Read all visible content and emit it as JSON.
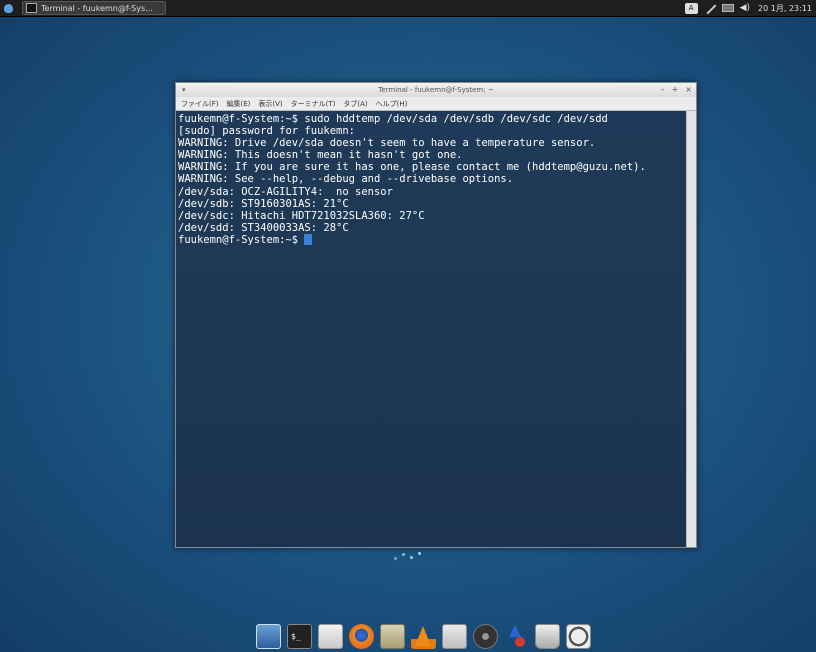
{
  "panel": {
    "task_title": "Terminal - fuukemn@f-Sys...",
    "keyboard_indicator": "A",
    "clock": "20 1月, 23:11",
    "volume_glyph": "◀)"
  },
  "window": {
    "title": "Terminal - fuukemn@f-System: ~",
    "menu": [
      "ファイル(F)",
      "編集(E)",
      "表示(V)",
      "ターミナル(T)",
      "タブ(A)",
      "ヘルプ(H)"
    ]
  },
  "terminal": {
    "lines": [
      "fuukemn@f-System:~$ sudo hddtemp /dev/sda /dev/sdb /dev/sdc /dev/sdd",
      "[sudo] password for fuukemn:",
      "WARNING: Drive /dev/sda doesn't seem to have a temperature sensor.",
      "WARNING: This doesn't mean it hasn't got one.",
      "WARNING: If you are sure it has one, please contact me (hddtemp@guzu.net).",
      "WARNING: See --help, --debug and --drivebase options.",
      "/dev/sda: OCZ-AGILITY4:  no sensor",
      "/dev/sdb: ST9160301AS: 21°C",
      "/dev/sdc: Hitachi HDT721032SLA360: 27°C",
      "/dev/sdd: ST3400033AS: 28°C"
    ],
    "prompt": "fuukemn@f-System:~$ "
  },
  "dock": {
    "items": [
      {
        "id": "show-desktop",
        "icon": "desktop-icon"
      },
      {
        "id": "terminal",
        "icon": "terminal-icon",
        "glyph": "$_"
      },
      {
        "id": "file-manager",
        "icon": "file-manager-icon"
      },
      {
        "id": "firefox",
        "icon": "firefox-icon"
      },
      {
        "id": "mail",
        "icon": "mail-icon"
      },
      {
        "id": "vlc",
        "icon": "vlc-icon"
      },
      {
        "id": "mixer",
        "icon": "mixer-icon"
      },
      {
        "id": "disc",
        "icon": "disc-icon"
      },
      {
        "id": "updates",
        "icon": "arrows-icon"
      },
      {
        "id": "trash",
        "icon": "trash-icon"
      },
      {
        "id": "power",
        "icon": "power-icon"
      }
    ]
  }
}
